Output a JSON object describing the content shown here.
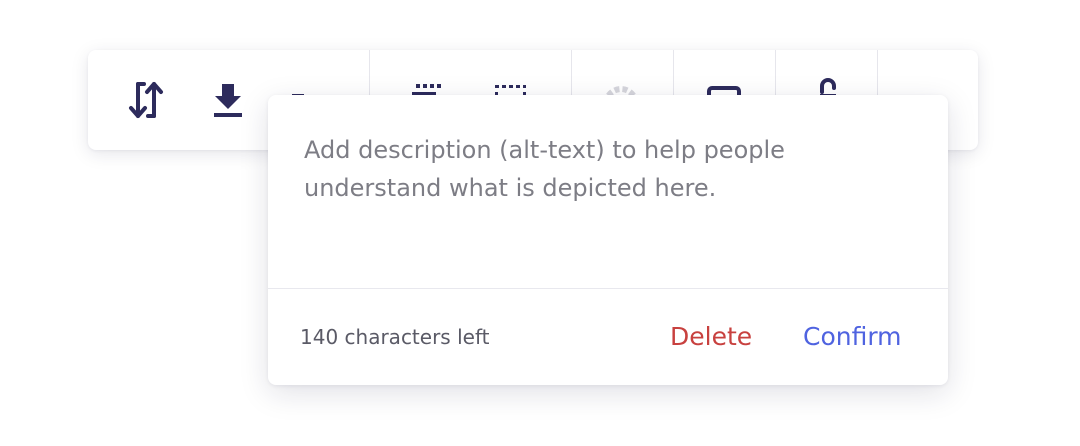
{
  "colors": {
    "icon": "#2d2b5c",
    "icon_muted": "#d6d6dc",
    "delete": "#c8413f",
    "confirm": "#4f63e0",
    "placeholder": "#7d7d85"
  },
  "toolbar": {
    "tools": [
      {
        "name": "swap-arrows-icon"
      },
      {
        "name": "download-icon"
      },
      {
        "name": "alt-text-icon"
      },
      {
        "name": "frame-dashed-top-icon"
      },
      {
        "name": "frame-dashed-icon"
      },
      {
        "name": "loading-spinner-icon"
      },
      {
        "name": "caption-icon"
      },
      {
        "name": "unlock-icon"
      }
    ]
  },
  "alt_text_popover": {
    "textarea_value": "",
    "placeholder": "Add description (alt-text) to help people understand what is depicted here.",
    "characters_left": "140 characters left",
    "delete_label": "Delete",
    "confirm_label": "Confirm"
  }
}
